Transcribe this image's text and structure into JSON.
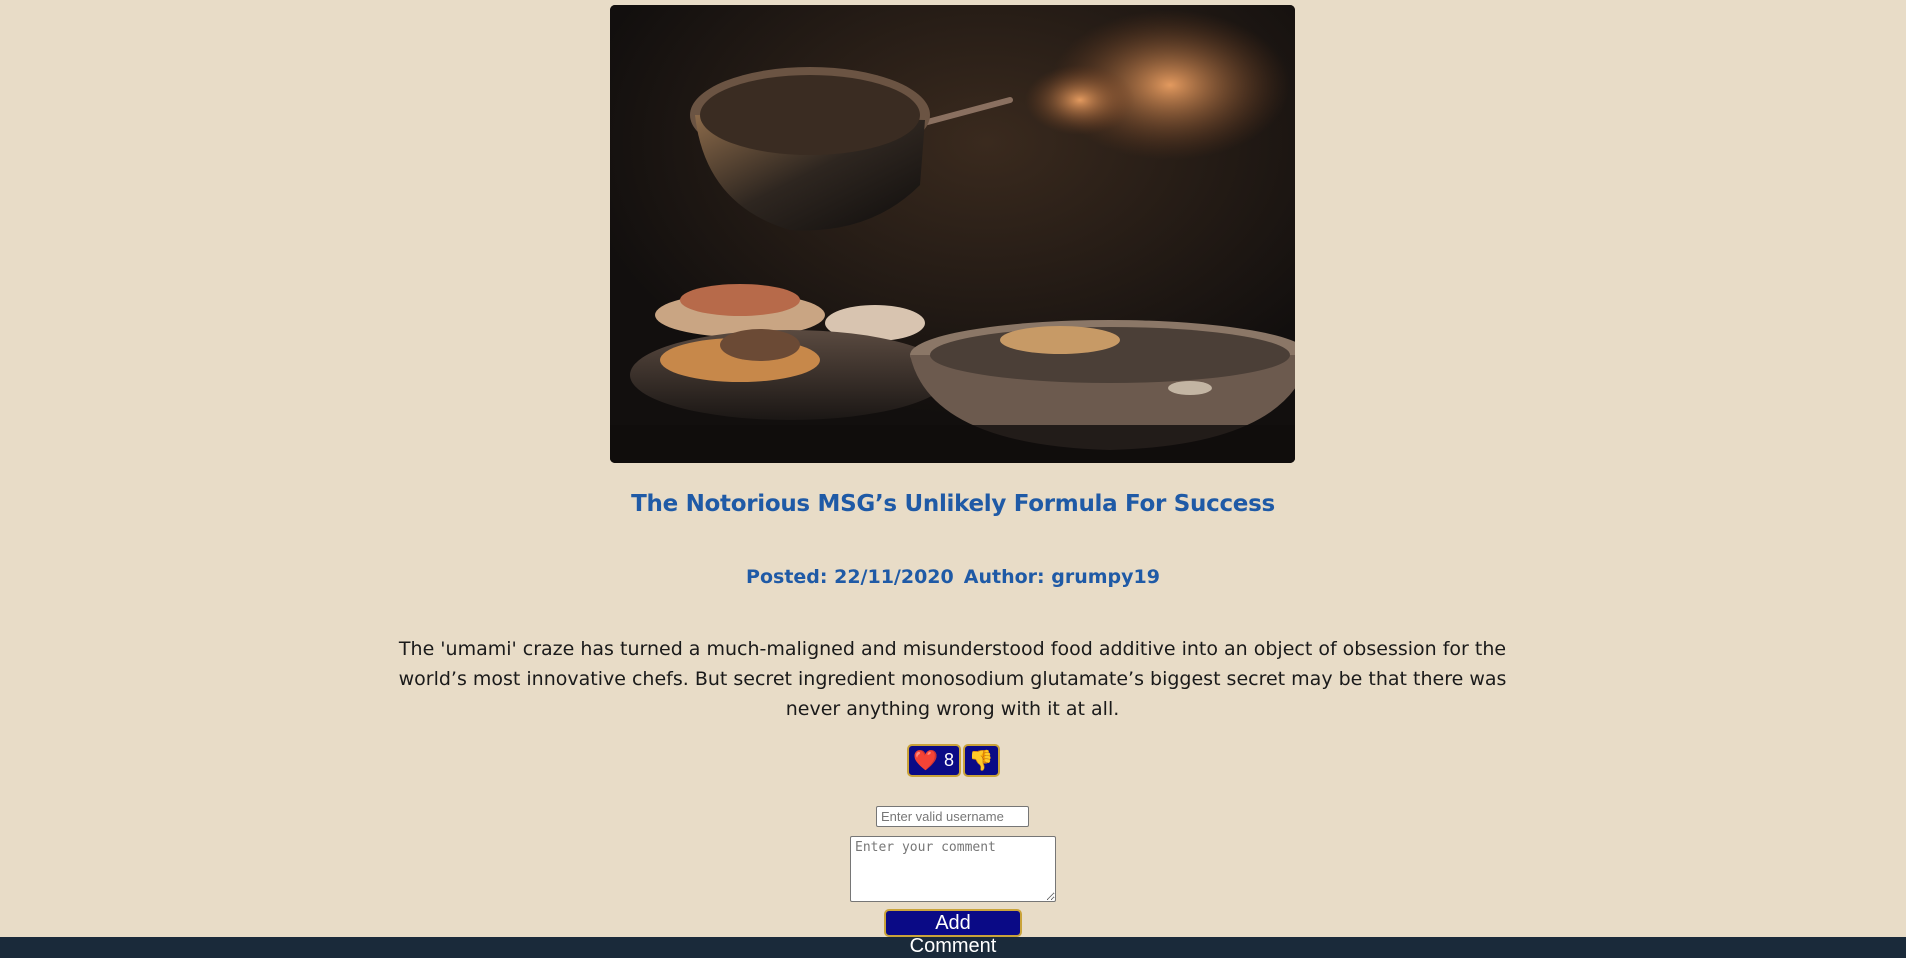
{
  "article": {
    "title": "The Notorious MSG’s Unlikely Formula For Success",
    "posted": "Posted: 22/11/2020",
    "author": "Author: grumpy19",
    "summary": "The 'umami' craze has turned a much-maligned and misunderstood food additive into an object of obsession for the world’s most innovative chefs. But secret ingredient monosodium glutamate’s biggest secret may be that there was never anything wrong with it at all.",
    "image_icon": "kitchen-photo"
  },
  "reactions": {
    "like_icon": "❤️",
    "like_count": "8",
    "dislike_icon": "👎"
  },
  "comment_form": {
    "username_placeholder": "Enter valid username",
    "comment_placeholder": "Enter your comment",
    "submit_label": "Add Comment"
  },
  "colors": {
    "page_background": "#e8dcc7",
    "heading": "#1f5aa6",
    "button_background": "#0a0a86",
    "button_border": "#c9a33a"
  }
}
